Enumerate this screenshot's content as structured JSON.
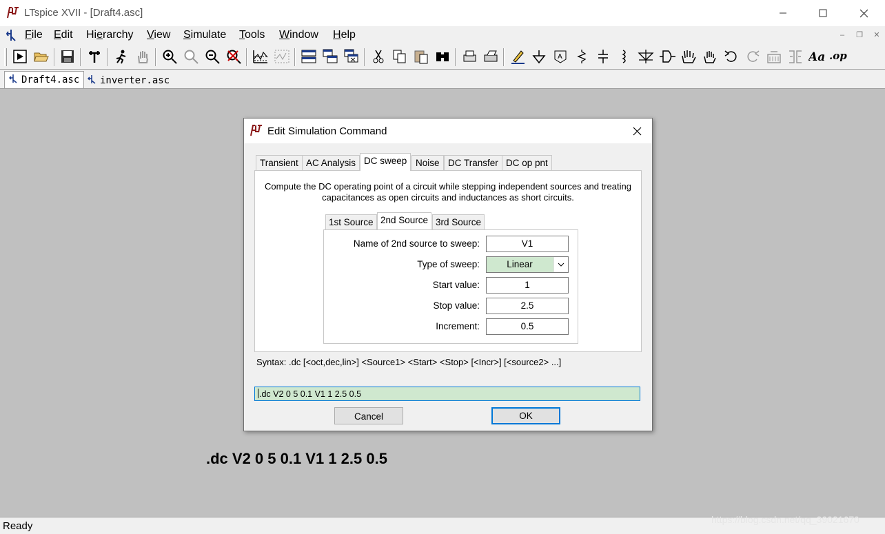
{
  "window": {
    "title": "LTspice XVII - [Draft4.asc]",
    "icon": "ltspice-logo-icon"
  },
  "menu": {
    "items": [
      {
        "accel": "F",
        "rest": "ile"
      },
      {
        "accel": "E",
        "rest": "dit"
      },
      {
        "pre": "Hi",
        "accel": "e",
        "rest": "rarchy"
      },
      {
        "accel": "V",
        "rest": "iew"
      },
      {
        "accel": "S",
        "rest": "imulate"
      },
      {
        "accel": "T",
        "rest": "ools"
      },
      {
        "accel": "W",
        "rest": "indow"
      },
      {
        "accel": "H",
        "rest": "elp"
      }
    ]
  },
  "toolbar": {
    "icons": [
      "run-icon",
      "open-icon",
      "save-icon",
      "control-panel-icon",
      "halt-icon",
      "hand-icon",
      "zoom-in-icon",
      "zoom-pan-icon",
      "zoom-out-icon",
      "zoom-cancel-icon",
      "autorange-icon",
      "waveform-icon",
      "tile-icon",
      "cascade-icon",
      "close-windows-icon",
      "cut-icon",
      "copy-icon",
      "paste-icon",
      "find-icon",
      "print-preview-icon",
      "print-icon",
      "draw-wire-icon",
      "ground-icon",
      "label-net-icon",
      "resistor-icon",
      "capacitor-icon",
      "inductor-icon",
      "diode-icon",
      "component-icon",
      "move-icon",
      "drag-icon",
      "undo-icon",
      "redo-icon",
      "rotate-icon",
      "mirror-icon",
      "text-icon",
      "spice-directive-icon"
    ]
  },
  "doc_tabs": [
    {
      "label": "Draft4.asc",
      "active": true
    },
    {
      "label": "inverter.asc",
      "active": false
    }
  ],
  "dialog": {
    "title": "Edit Simulation Command",
    "tabs": [
      "Transient",
      "AC Analysis",
      "DC sweep",
      "Noise",
      "DC Transfer",
      "DC op pnt"
    ],
    "active_tab": "DC sweep",
    "description_line1": "Compute the DC operating point of a circuit while stepping independent sources and treating",
    "description_line2": "capacitances as open circuits and inductances as short circuits.",
    "subtabs": [
      "1st Source",
      "2nd Source",
      "3rd Source"
    ],
    "active_subtab": "2nd Source",
    "fields": {
      "name_label": "Name of 2nd source to sweep:",
      "name_value": "V1",
      "type_label": "Type of sweep:",
      "type_value": "Linear",
      "start_label": "Start value:",
      "start_value": "1",
      "stop_label": "Stop value:",
      "stop_value": "2.5",
      "incr_label": "Increment:",
      "incr_value": "0.5"
    },
    "syntax": "Syntax: .dc [<oct,dec,lin>] <Source1> <Start> <Stop> [<Incr>] [<source2> ...]",
    "command": ".dc V2 0 5 0.1 V1 1 2.5 0.5",
    "cancel_label": "Cancel",
    "ok_label": "OK"
  },
  "canvas": {
    "directive_text": ".dc V2 0 5 0.1 V1 1 2.5 0.5"
  },
  "status": {
    "text": "Ready"
  },
  "watermark": "https://blog.csdn.net/qq_39021670",
  "colors": {
    "canvas_bg": "#c0c0c0",
    "field_green": "#cfe8cf",
    "focus_blue": "#0078d7"
  }
}
